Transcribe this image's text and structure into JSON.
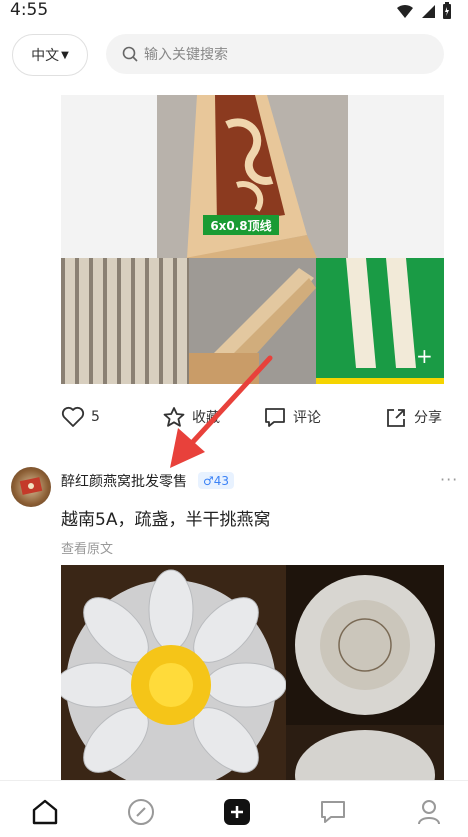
{
  "status_bar": {
    "time": "4:55",
    "icons": [
      "wifi-icon",
      "signal-icon",
      "battery-icon"
    ]
  },
  "top_bar": {
    "language_label": "中文",
    "search_placeholder": "输入关键搜索"
  },
  "post1": {
    "image_badge": "6x0.8顶线",
    "actions": {
      "like_count": "5",
      "favorite_label": "收藏",
      "comment_label": "评论",
      "share_label": "分享"
    }
  },
  "post2": {
    "author": "醉红颜燕窝批发零售",
    "badge_text": "♂43",
    "more": "···",
    "text": "越南5A，疏盏，半干挑燕窝",
    "view_original": "查看原文"
  },
  "bottom_nav": {
    "items": [
      "home-icon",
      "discover-icon",
      "add-icon",
      "messages-icon",
      "profile-icon"
    ]
  },
  "colors": {
    "accent_blue": "#3b82f6",
    "badge_green": "#1a9b33",
    "annotation_red": "#e8413b"
  }
}
